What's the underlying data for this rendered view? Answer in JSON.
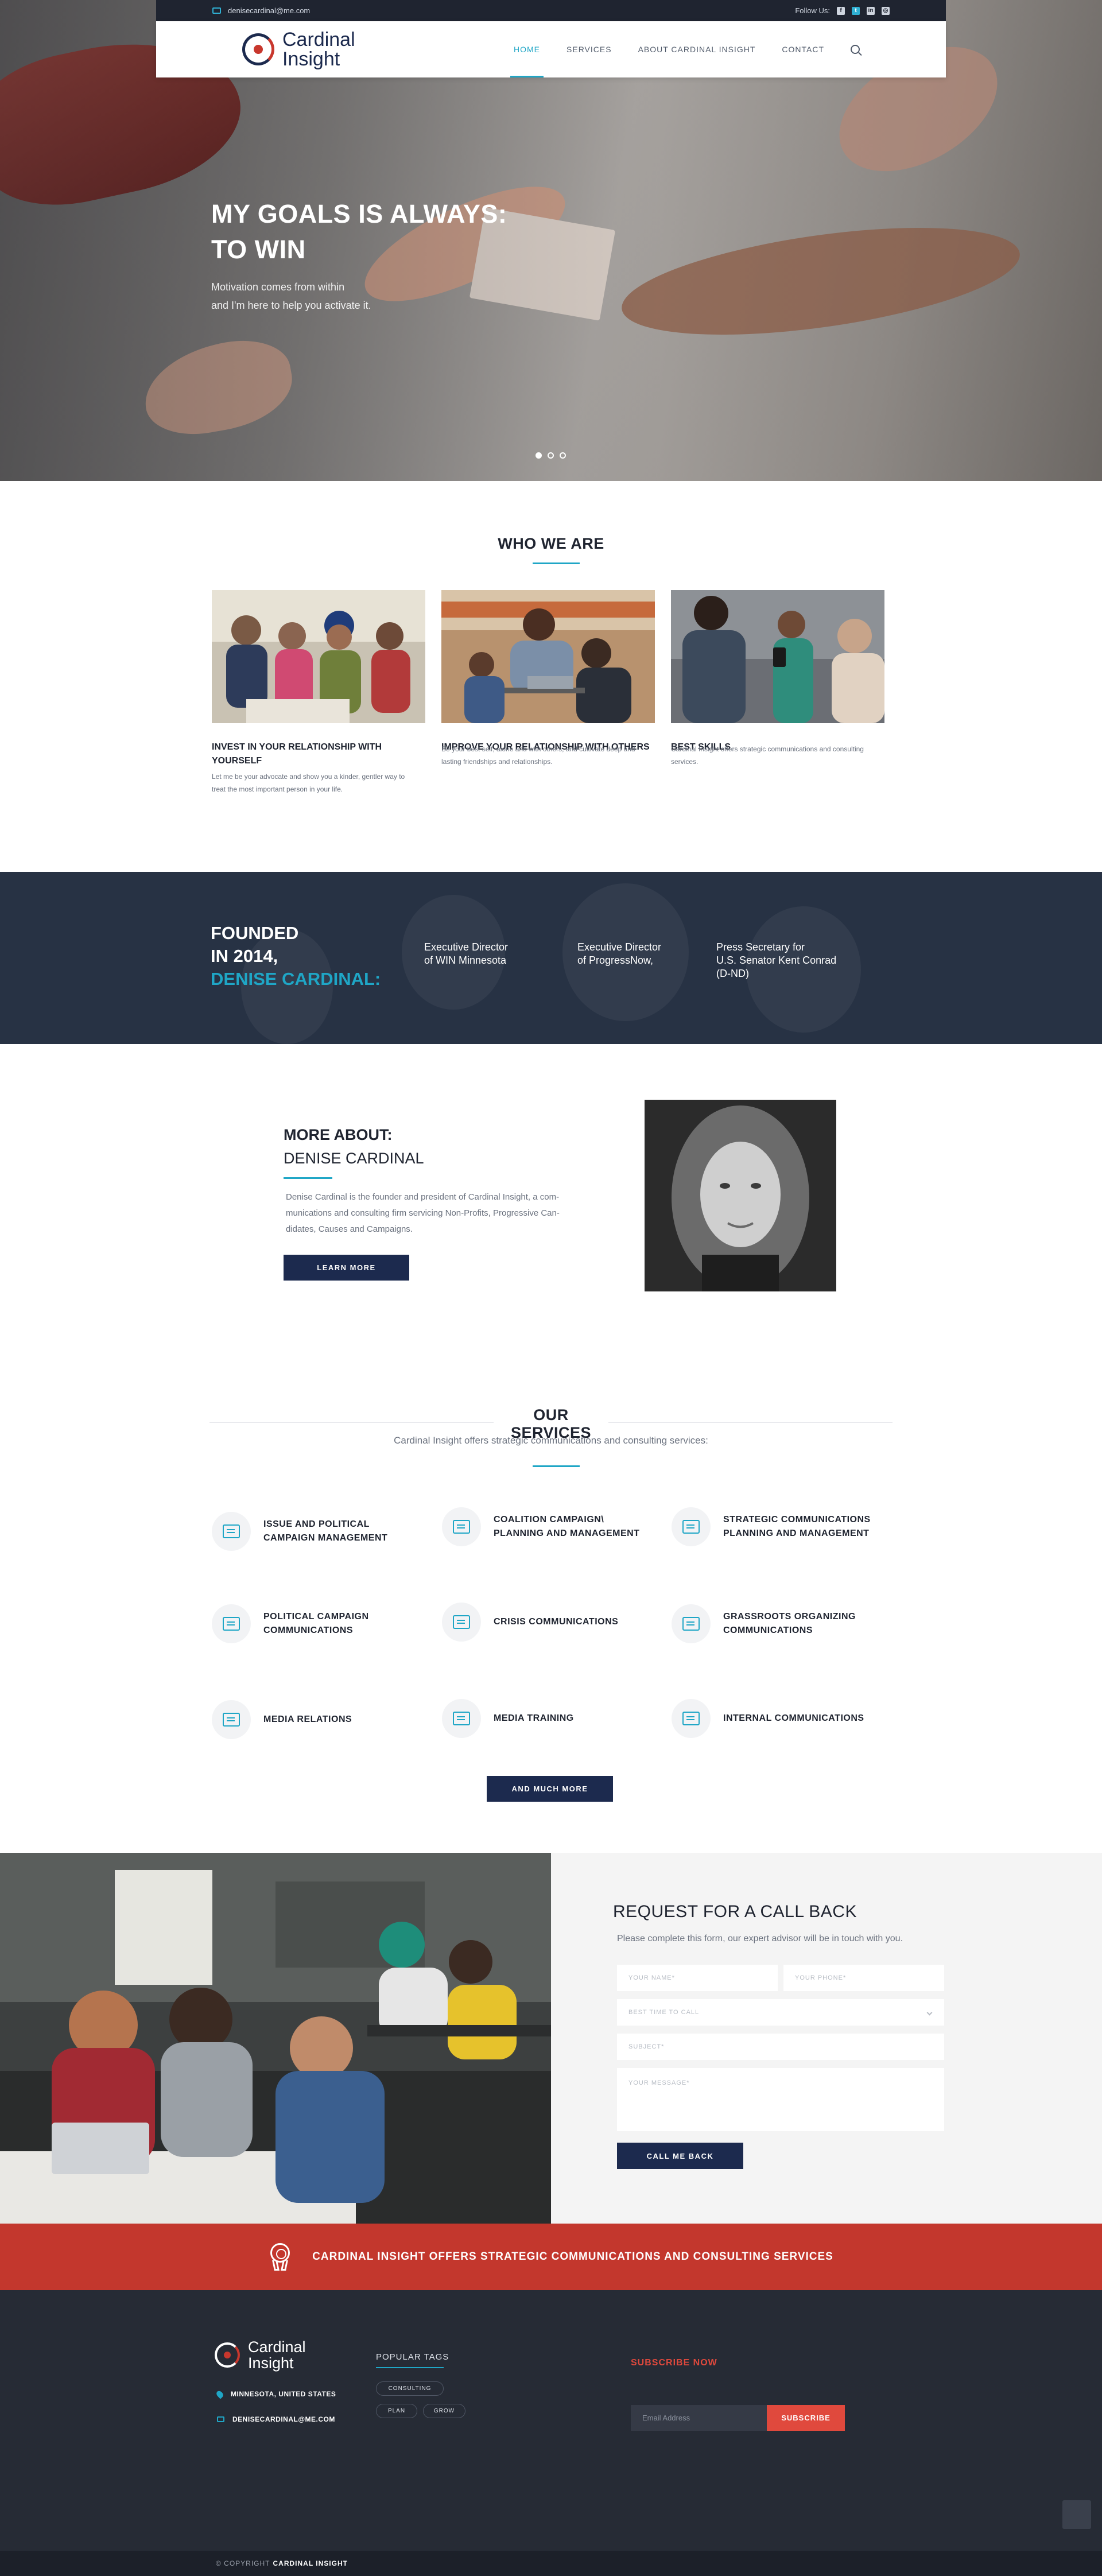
{
  "topbar": {
    "email": "denisecardinal@me.com",
    "follow_label": "Follow Us:",
    "social_icons": [
      "facebook-icon",
      "twitter-icon",
      "linkedin-icon",
      "instagram-icon"
    ]
  },
  "brand": {
    "line1": "Cardinal",
    "line2": "Insight"
  },
  "nav": {
    "items": [
      "HOME",
      "SERVICES",
      "ABOUT CARDINAL INSIGHT",
      "CONTACT"
    ],
    "active": "HOME"
  },
  "hero": {
    "title_line1": "MY GOALS IS ALWAYS:",
    "title_line2": "TO WIN",
    "sub_line1": "Motivation comes from within",
    "sub_line2": "and I'm here to help you activate it.",
    "slides": 3,
    "active_slide": 1
  },
  "who": {
    "title": "WHO WE ARE",
    "cards": [
      {
        "title_line1": "INVEST IN YOUR RELATIONSHIP WITH",
        "title_line2": "YOURSELF",
        "text_line1": "Let me be your advocate and show you a kinder, gentler way to",
        "text_line2": "treat the most important person in your life."
      },
      {
        "title_line1": "IMPROVE YOUR RELATIONSHIP WITH OTHERS",
        "title_line2": "",
        "text_line1": "Be your best self, alone and with others, and cultivate deep and",
        "text_line2": "lasting friendships and relationships."
      },
      {
        "title_line1": "BEST SKILLS",
        "title_line2": "",
        "text_line1": "Cardinal Insight offers strategic communications and consulting",
        "text_line2": "services."
      }
    ]
  },
  "founded": {
    "line1": "FOUNDED",
    "line2": "IN 2014,",
    "name": "DENISE CARDINAL:",
    "items": [
      {
        "line1": "Executive Director",
        "line2": "of WIN Minnesota",
        "line3": ""
      },
      {
        "line1": "Executive Director",
        "line2": "of ProgressNow,",
        "line3": ""
      },
      {
        "line1": "Press Secretary for",
        "line2": "U.S. Senator Kent Conrad",
        "line3": "(D-ND)"
      }
    ]
  },
  "about": {
    "heading_line1": "MORE ABOUT:",
    "heading_line2": "DENISE CARDINAL",
    "text_line1": "Denise Cardinal is the founder and president of Cardinal Insight, a com-",
    "text_line2": "munications and consulting firm servicing Non-Profits, Progressive Can-",
    "text_line3": "didates, Causes and Campaigns.",
    "button": "LEARN MORE"
  },
  "services": {
    "title": "OUR SERVICES",
    "subtitle": "Cardinal Insight offers strategic communications and consulting services:",
    "items": [
      {
        "line1": "ISSUE AND POLITICAL",
        "line2": "CAMPAIGN MANAGEMENT",
        "icon": "courthouse-icon"
      },
      {
        "line1": "COALITION CAMPAIGN\\",
        "line2": "PLANNING AND MANAGEMENT",
        "icon": "clipboard-pen-icon"
      },
      {
        "line1": "STRATEGIC COMMUNICATIONS",
        "line2": "PLANNING AND MANAGEMENT",
        "icon": "safe-icon"
      },
      {
        "line1": "POLITICAL CAMPAIGN",
        "line2": "COMMUNICATIONS",
        "icon": "speech-bubbles-icon"
      },
      {
        "line1": "CRISIS COMMUNICATIONS",
        "line2": "",
        "icon": "line-chart-icon"
      },
      {
        "line1": "GRASSROOTS ORGANIZING",
        "line2": "COMMUNICATIONS",
        "icon": "building-icon"
      },
      {
        "line1": "MEDIA RELATIONS",
        "line2": "",
        "icon": "gavel-icon"
      },
      {
        "line1": "MEDIA TRAINING",
        "line2": "",
        "icon": "monitor-icon"
      },
      {
        "line1": "INTERNAL COMMUNICATIONS",
        "line2": "",
        "icon": "document-pen-icon"
      }
    ],
    "button": "AND MUCH MORE"
  },
  "callback": {
    "title": "REQUEST FOR A CALL BACK",
    "subtitle": "Please complete this form, our expert advisor will be in touch with you.",
    "name_placeholder": "YOUR NAME*",
    "phone_placeholder": "YOUR PHONE*",
    "time_placeholder": "BEST TIME TO CALL",
    "subject_placeholder": "SUBJECT*",
    "message_placeholder": "YOUR MESSAGE*",
    "button": "CALL ME BACK"
  },
  "banner": {
    "text": "CARDINAL INSIGHT OFFERS STRATEGIC COMMUNICATIONS AND CONSULTING SERVICES"
  },
  "footer": {
    "location": "MINNESOTA, UNITED STATES",
    "email": "DENISECARDINAL@ME.COM",
    "tags_title": "POPULAR TAGS",
    "tags": [
      "CONSULTING",
      "PLAN",
      "GROW"
    ],
    "subscribe_title": "SUBSCRIBE NOW",
    "email_placeholder": "Email Address",
    "subscribe_button": "SUBSCRIBE",
    "copyright_prefix": "© COPYRIGHT",
    "copyright_brand": "CARDINAL INSIGHT"
  },
  "colors": {
    "navy": "#1c2a4e",
    "accent": "#1fa6c6",
    "red": "#c3372d",
    "dark": "#262b35"
  }
}
